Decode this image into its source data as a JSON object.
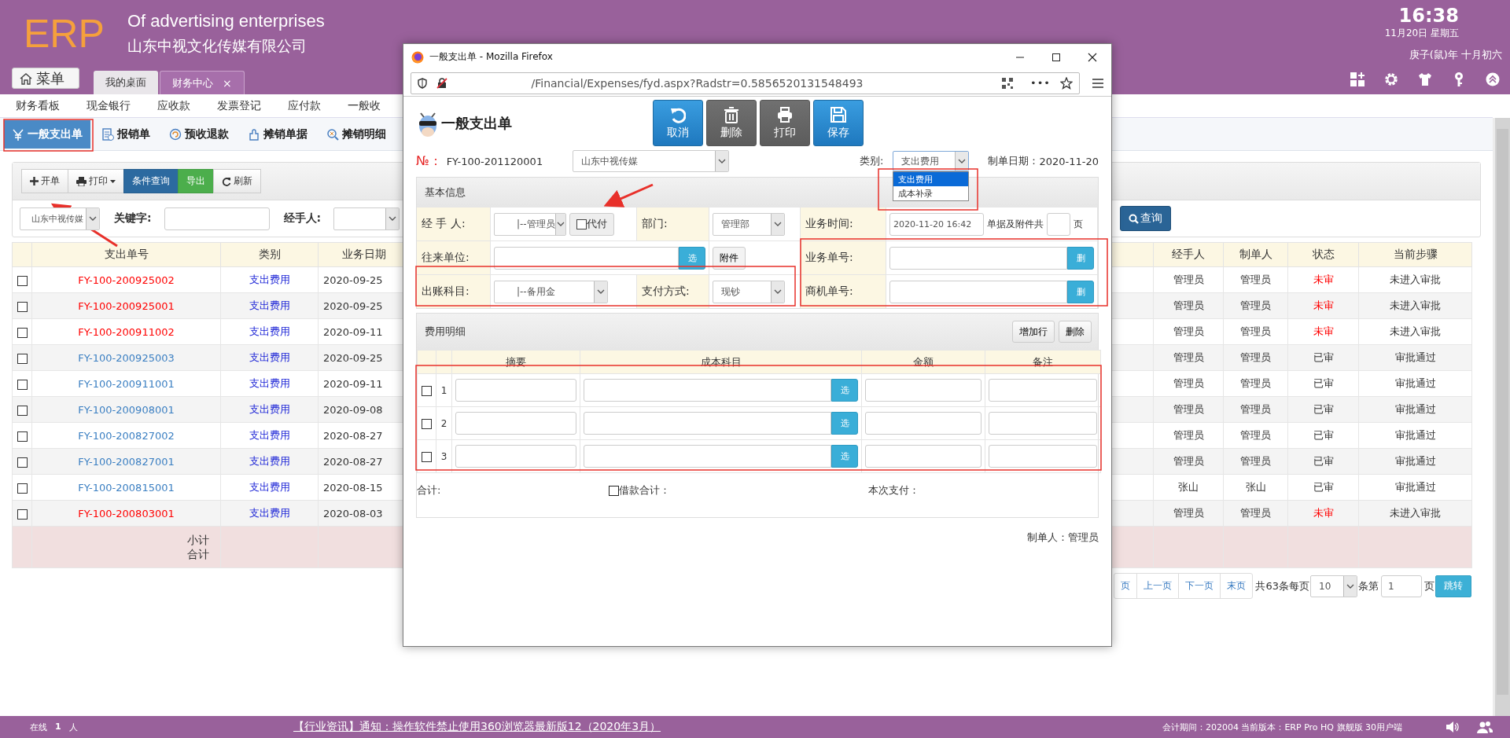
{
  "app": {
    "logo": "ERP",
    "tagline": "Of advertising enterprises",
    "company": "山东中视文化传媒有限公司",
    "clock": {
      "time": "16:38",
      "date": "11月20日 星期五",
      "lunar": "庚子(鼠)年 十月初六"
    }
  },
  "menu_button": "菜单",
  "tabs": [
    {
      "label": "我的桌面",
      "selected": false
    },
    {
      "label": "财务中心",
      "selected": true,
      "close": "×"
    }
  ],
  "nav": [
    "财务看板",
    "现金银行",
    "应收款",
    "发票登记",
    "应付款",
    "一般收"
  ],
  "subtabs": [
    {
      "label": "一般支出单",
      "selected": true
    },
    {
      "label": "报销单",
      "selected": false
    },
    {
      "label": "预收退款",
      "selected": false
    },
    {
      "label": "摊销单据",
      "selected": false
    },
    {
      "label": "摊销明细",
      "selected": false
    }
  ],
  "toolbar": [
    {
      "label": "开单",
      "kind": "add"
    },
    {
      "label": "打印",
      "kind": "print"
    },
    {
      "label": "条件查询",
      "kind": "query"
    },
    {
      "label": "导出",
      "kind": "export"
    },
    {
      "label": "刷新",
      "kind": "refresh"
    }
  ],
  "filter": {
    "company": "山东中视传媒",
    "keyword_label": "关键字:",
    "handler_label": "经手人:",
    "search_button": "查询"
  },
  "table": {
    "columns": [
      "支出单号",
      "类别",
      "业务日期",
      "经手人",
      "制单人",
      "状态",
      "当前步骤"
    ],
    "rows": [
      {
        "checked": false,
        "number": "FY-100-200925002",
        "category": "支出费用",
        "date": "2020-09-25",
        "handler": "管理员",
        "maker": "管理员",
        "approved": false,
        "status": "未审",
        "step": "未进入审批"
      },
      {
        "checked": false,
        "number": "FY-100-200925001",
        "category": "支出费用",
        "date": "2020-09-25",
        "handler": "管理员",
        "maker": "管理员",
        "approved": false,
        "status": "未审",
        "step": "未进入审批"
      },
      {
        "checked": false,
        "number": "FY-100-200911002",
        "category": "支出费用",
        "date": "2020-09-11",
        "handler": "管理员",
        "maker": "管理员",
        "approved": false,
        "status": "未审",
        "step": "未进入审批"
      },
      {
        "checked": false,
        "number": "FY-100-200925003",
        "category": "支出费用",
        "date": "2020-09-25",
        "handler": "管理员",
        "maker": "管理员",
        "approved": true,
        "status": "已审",
        "step": "审批通过"
      },
      {
        "checked": false,
        "number": "FY-100-200911001",
        "category": "支出费用",
        "date": "2020-09-11",
        "handler": "管理员",
        "maker": "管理员",
        "approved": true,
        "status": "已审",
        "step": "审批通过"
      },
      {
        "checked": false,
        "number": "FY-100-200908001",
        "category": "支出费用",
        "date": "2020-09-08",
        "handler": "管理员",
        "maker": "管理员",
        "approved": true,
        "status": "已审",
        "step": "审批通过"
      },
      {
        "checked": false,
        "number": "FY-100-200827002",
        "category": "支出费用",
        "date": "2020-08-27",
        "handler": "管理员",
        "maker": "管理员",
        "approved": true,
        "status": "已审",
        "step": "审批通过"
      },
      {
        "checked": false,
        "number": "FY-100-200827001",
        "category": "支出费用",
        "date": "2020-08-27",
        "handler": "管理员",
        "maker": "管理员",
        "approved": true,
        "status": "已审",
        "step": "审批通过"
      },
      {
        "checked": false,
        "number": "FY-100-200815001",
        "category": "支出费用",
        "date": "2020-08-15",
        "handler": "张山",
        "maker": "张山",
        "approved": true,
        "status": "已审",
        "step": "审批通过"
      },
      {
        "checked": false,
        "number": "FY-100-200803001",
        "category": "支出费用",
        "date": "2020-08-03",
        "handler": "管理员",
        "maker": "管理员",
        "approved": false,
        "status": "未审",
        "step": "未进入审批"
      }
    ],
    "totals": [
      "小计",
      "合计"
    ]
  },
  "pagination": {
    "links": [
      "页",
      "上一页",
      "下一页",
      "末页"
    ],
    "summary": "共63条每页",
    "page_size": "10",
    "page_label": "条第",
    "page": "1",
    "page_suffix": "页",
    "go": "跳转"
  },
  "popup": {
    "title": "一般支出单 - Mozilla Firefox",
    "url": "/Financial/Expenses/fyd.aspx?Radstr=0.5856520131548493",
    "more": "•••",
    "heading": "一般支出单",
    "actions": [
      {
        "label": "取消",
        "kind": "cancel"
      },
      {
        "label": "删除",
        "kind": "delete"
      },
      {
        "label": "打印",
        "kind": "print"
      },
      {
        "label": "保存",
        "kind": "save"
      }
    ],
    "number_label": "№：",
    "number": "FY-100-201120001",
    "company": "山东中视传媒",
    "category_label": "类别:",
    "category": "支出费用",
    "category_options": [
      {
        "label": "支出费用",
        "selected": true
      },
      {
        "label": "成本补录",
        "selected": false
      }
    ],
    "date_label": "制单日期：",
    "date": "2020-11-20",
    "basic": {
      "title": "基本信息",
      "handler_label": "经 手 人:",
      "handler": "|--管理员",
      "proxy": {
        "label": "代付",
        "checked": false
      },
      "dept_label": "部门:",
      "dept": "管理部",
      "time_label": "业务时间:",
      "time": "2020-11-20 16:42",
      "attach_label": "单据及附件共",
      "attach_unit": "页",
      "partner_label": "往来单位:",
      "partner_pick": "选",
      "attach_button": "附件",
      "biz_no_label": "业务单号:",
      "biz_clear": "删",
      "account_label": "出账科目:",
      "account": "|--备用金",
      "pay_label": "支付方式:",
      "pay": "现钞",
      "opp_no_label": "商机单号:",
      "opp_clear": "删"
    },
    "details": {
      "title": "费用明细",
      "buttons": [
        "增加行",
        "删除"
      ],
      "columns": [
        "摘要",
        "成本科目",
        "金额",
        "备注"
      ],
      "rows": [
        {
          "checked": false,
          "index": "1",
          "pick": "选"
        },
        {
          "checked": false,
          "index": "2",
          "pick": "选"
        },
        {
          "checked": false,
          "index": "3",
          "pick": "选"
        }
      ],
      "total_label": "合计:",
      "loan": {
        "label": "借款合计：",
        "checked": false
      },
      "pay_label": "本次支付："
    },
    "maker": "制单人：管理员"
  },
  "status_bar": {
    "online_label": "在线",
    "online_count": "1",
    "online_unit": "人",
    "notice": "【行业资讯】通知：操作软件禁止使用360浏览器最新版12（2020年3月）",
    "info": "会计期间：202004 当前版本：ERP Pro HQ 旗舰版 30用户端"
  }
}
